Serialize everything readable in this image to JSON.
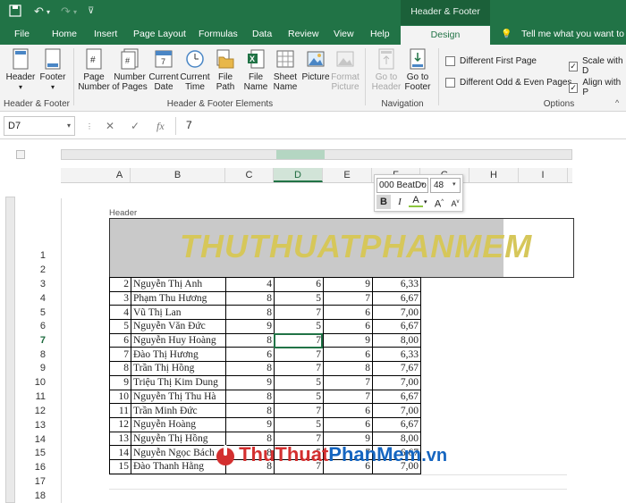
{
  "title_bar": {
    "context_title": "Header & Footer Tools"
  },
  "tabs": [
    "File",
    "Home",
    "Insert",
    "Page Layout",
    "Formulas",
    "Data",
    "Review",
    "View",
    "Help",
    "Design",
    "Tell me what you want to do"
  ],
  "ribbon": {
    "hf": {
      "header": "Header",
      "footer": "Footer",
      "group": "Header & Footer"
    },
    "elements": {
      "page_number": [
        "Page",
        "Number"
      ],
      "number_of_pages": [
        "Number",
        "of Pages"
      ],
      "current_date": [
        "Current",
        "Date"
      ],
      "current_time": [
        "Current",
        "Time"
      ],
      "file_path": [
        "File",
        "Path"
      ],
      "file_name": [
        "File",
        "Name"
      ],
      "sheet_name": [
        "Sheet",
        "Name"
      ],
      "picture": "Picture",
      "format_picture": [
        "Format",
        "Picture"
      ],
      "group": "Header & Footer Elements"
    },
    "nav": {
      "goto_header": [
        "Go to",
        "Header"
      ],
      "goto_footer": [
        "Go to",
        "Footer"
      ],
      "group": "Navigation"
    },
    "options": {
      "different_first_page": "Different First Page",
      "different_odd_even": "Different Odd & Even Pages",
      "scale_with_doc": "Scale with D",
      "align_with_margins": "Align with P",
      "group": "Options"
    }
  },
  "formula_bar": {
    "name_box": "D7",
    "formula_value": "7"
  },
  "columns": [
    "A",
    "B",
    "C",
    "D",
    "E",
    "F",
    "G",
    "H",
    "I"
  ],
  "rows": [
    "1",
    "2",
    "3",
    "4",
    "5",
    "6",
    "7",
    "8",
    "9",
    "10",
    "11",
    "12",
    "13",
    "14",
    "15",
    "16",
    "17",
    "18"
  ],
  "header_label": "Header",
  "watermark_text": "THUTHUATPHANMEM",
  "mini_toolbar": {
    "font": "000 BeatDo",
    "size": "48"
  },
  "table": [
    {
      "stt": "2",
      "name": "Nguyễn Thị Anh",
      "c": "4",
      "d": "6",
      "e": "9",
      "f": "6,33"
    },
    {
      "stt": "3",
      "name": "Phạm Thu Hương",
      "c": "8",
      "d": "5",
      "e": "7",
      "f": "6,67"
    },
    {
      "stt": "4",
      "name": "Vũ Thị Lan",
      "c": "8",
      "d": "7",
      "e": "6",
      "f": "7,00"
    },
    {
      "stt": "5",
      "name": "Nguyễn Văn Đức",
      "c": "9",
      "d": "5",
      "e": "6",
      "f": "6,67"
    },
    {
      "stt": "6",
      "name": "Nguyễn Huy Hoàng",
      "c": "8",
      "d": "7",
      "e": "9",
      "f": "8,00"
    },
    {
      "stt": "7",
      "name": "Đào Thị Hương",
      "c": "6",
      "d": "7",
      "e": "6",
      "f": "6,33"
    },
    {
      "stt": "8",
      "name": "Trần Thị Hồng",
      "c": "8",
      "d": "7",
      "e": "8",
      "f": "7,67"
    },
    {
      "stt": "9",
      "name": "Triệu Thị Kim Dung",
      "c": "9",
      "d": "5",
      "e": "7",
      "f": "7,00"
    },
    {
      "stt": "10",
      "name": "Nguyễn Thị Thu Hà",
      "c": "8",
      "d": "5",
      "e": "7",
      "f": "6,67"
    },
    {
      "stt": "11",
      "name": "Trần Minh Đức",
      "c": "8",
      "d": "7",
      "e": "6",
      "f": "7,00"
    },
    {
      "stt": "12",
      "name": "Nguyễn Hoàng",
      "c": "9",
      "d": "5",
      "e": "6",
      "f": "6,67"
    },
    {
      "stt": "13",
      "name": "Nguyễn Thị Hồng",
      "c": "8",
      "d": "7",
      "e": "9",
      "f": "8,00"
    },
    {
      "stt": "14",
      "name": "Nguyễn Ngọc Bách",
      "c": "8",
      "d": "5",
      "e": "7",
      "f": "6,67"
    },
    {
      "stt": "15",
      "name": "Đào Thanh Hằng",
      "c": "8",
      "d": "7",
      "e": "6",
      "f": "7,00"
    }
  ],
  "brand_logo": {
    "thu": "Thu",
    "thuat": "Thuat",
    "phan": "Phan",
    "mem": "Mem",
    "vn": ".vn"
  },
  "colors": {
    "excel_green": "#217346",
    "watermark": "#d6c75a",
    "brand_red": "#d32f2f",
    "brand_blue": "#1565c0"
  }
}
